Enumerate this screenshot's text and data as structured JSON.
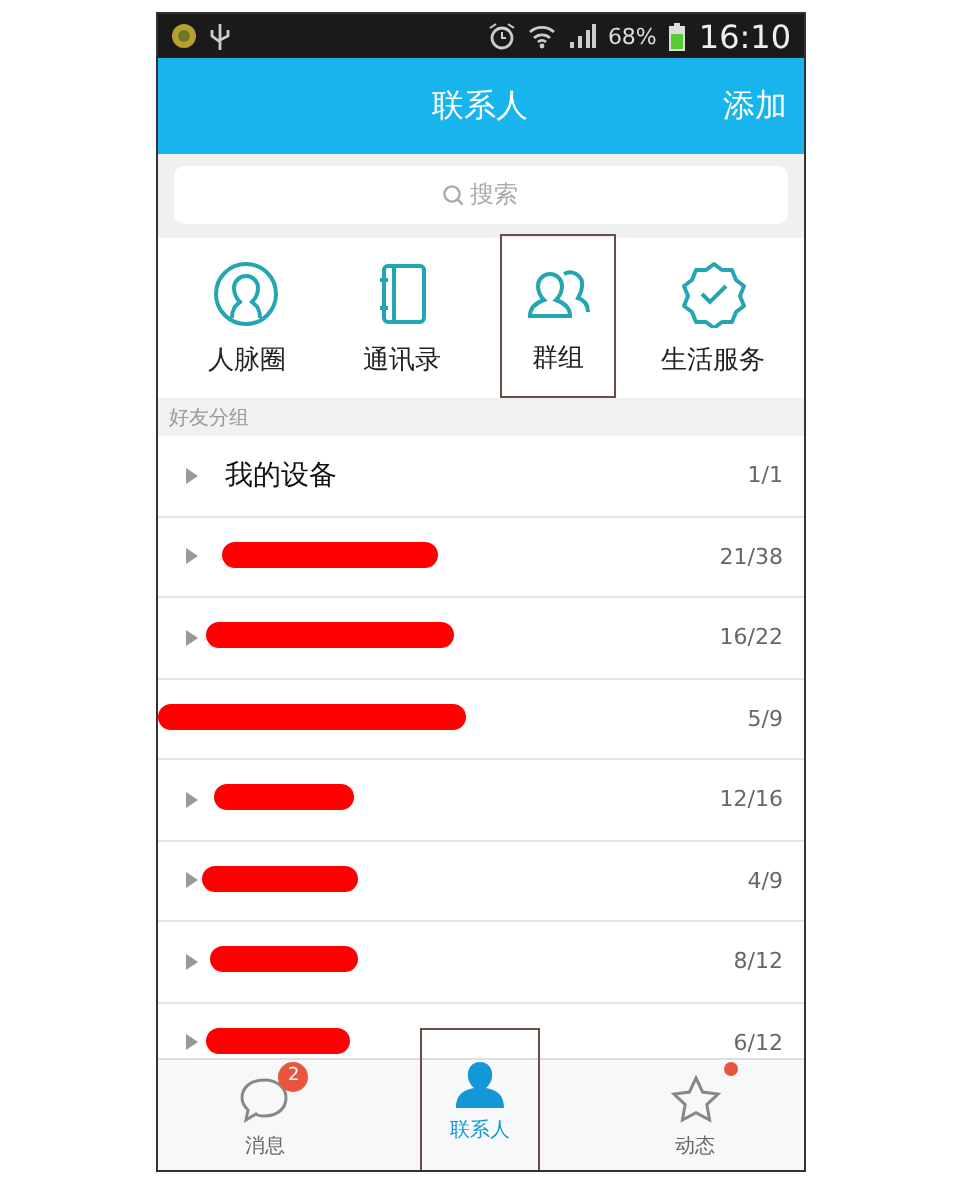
{
  "status_bar": {
    "battery": "68%",
    "time": "16:10"
  },
  "header": {
    "title": "联系人",
    "action": "添加"
  },
  "search": {
    "placeholder": "搜索"
  },
  "shortcuts": [
    {
      "kind": "circle",
      "label": "人脉圈",
      "annotated": false
    },
    {
      "kind": "book",
      "label": "通讯录",
      "annotated": false
    },
    {
      "kind": "group",
      "label": "群组",
      "annotated": true
    },
    {
      "kind": "badge",
      "label": "生活服务",
      "annotated": false
    }
  ],
  "section_title": "好友分组",
  "groups": [
    {
      "kind": "named",
      "name": "我的设备",
      "count": "1/1"
    },
    {
      "kind": "redacted",
      "count": "21/38"
    },
    {
      "kind": "redacted",
      "count": "16/22"
    },
    {
      "kind": "redacted",
      "count": "5/9"
    },
    {
      "kind": "redacted",
      "count": "12/16"
    },
    {
      "kind": "redacted",
      "count": "4/9"
    },
    {
      "kind": "redacted",
      "count": "8/12"
    },
    {
      "kind": "redacted",
      "count": "6/12"
    }
  ],
  "tabs": [
    {
      "kind": "chat",
      "label": "消息",
      "selected": false,
      "badge": "2",
      "dot": false,
      "annotated": false
    },
    {
      "kind": "person",
      "label": "联系人",
      "selected": true,
      "dot": false,
      "annotated": true
    },
    {
      "kind": "star",
      "label": "动态",
      "selected": false,
      "dot": true,
      "annotated": false
    }
  ]
}
